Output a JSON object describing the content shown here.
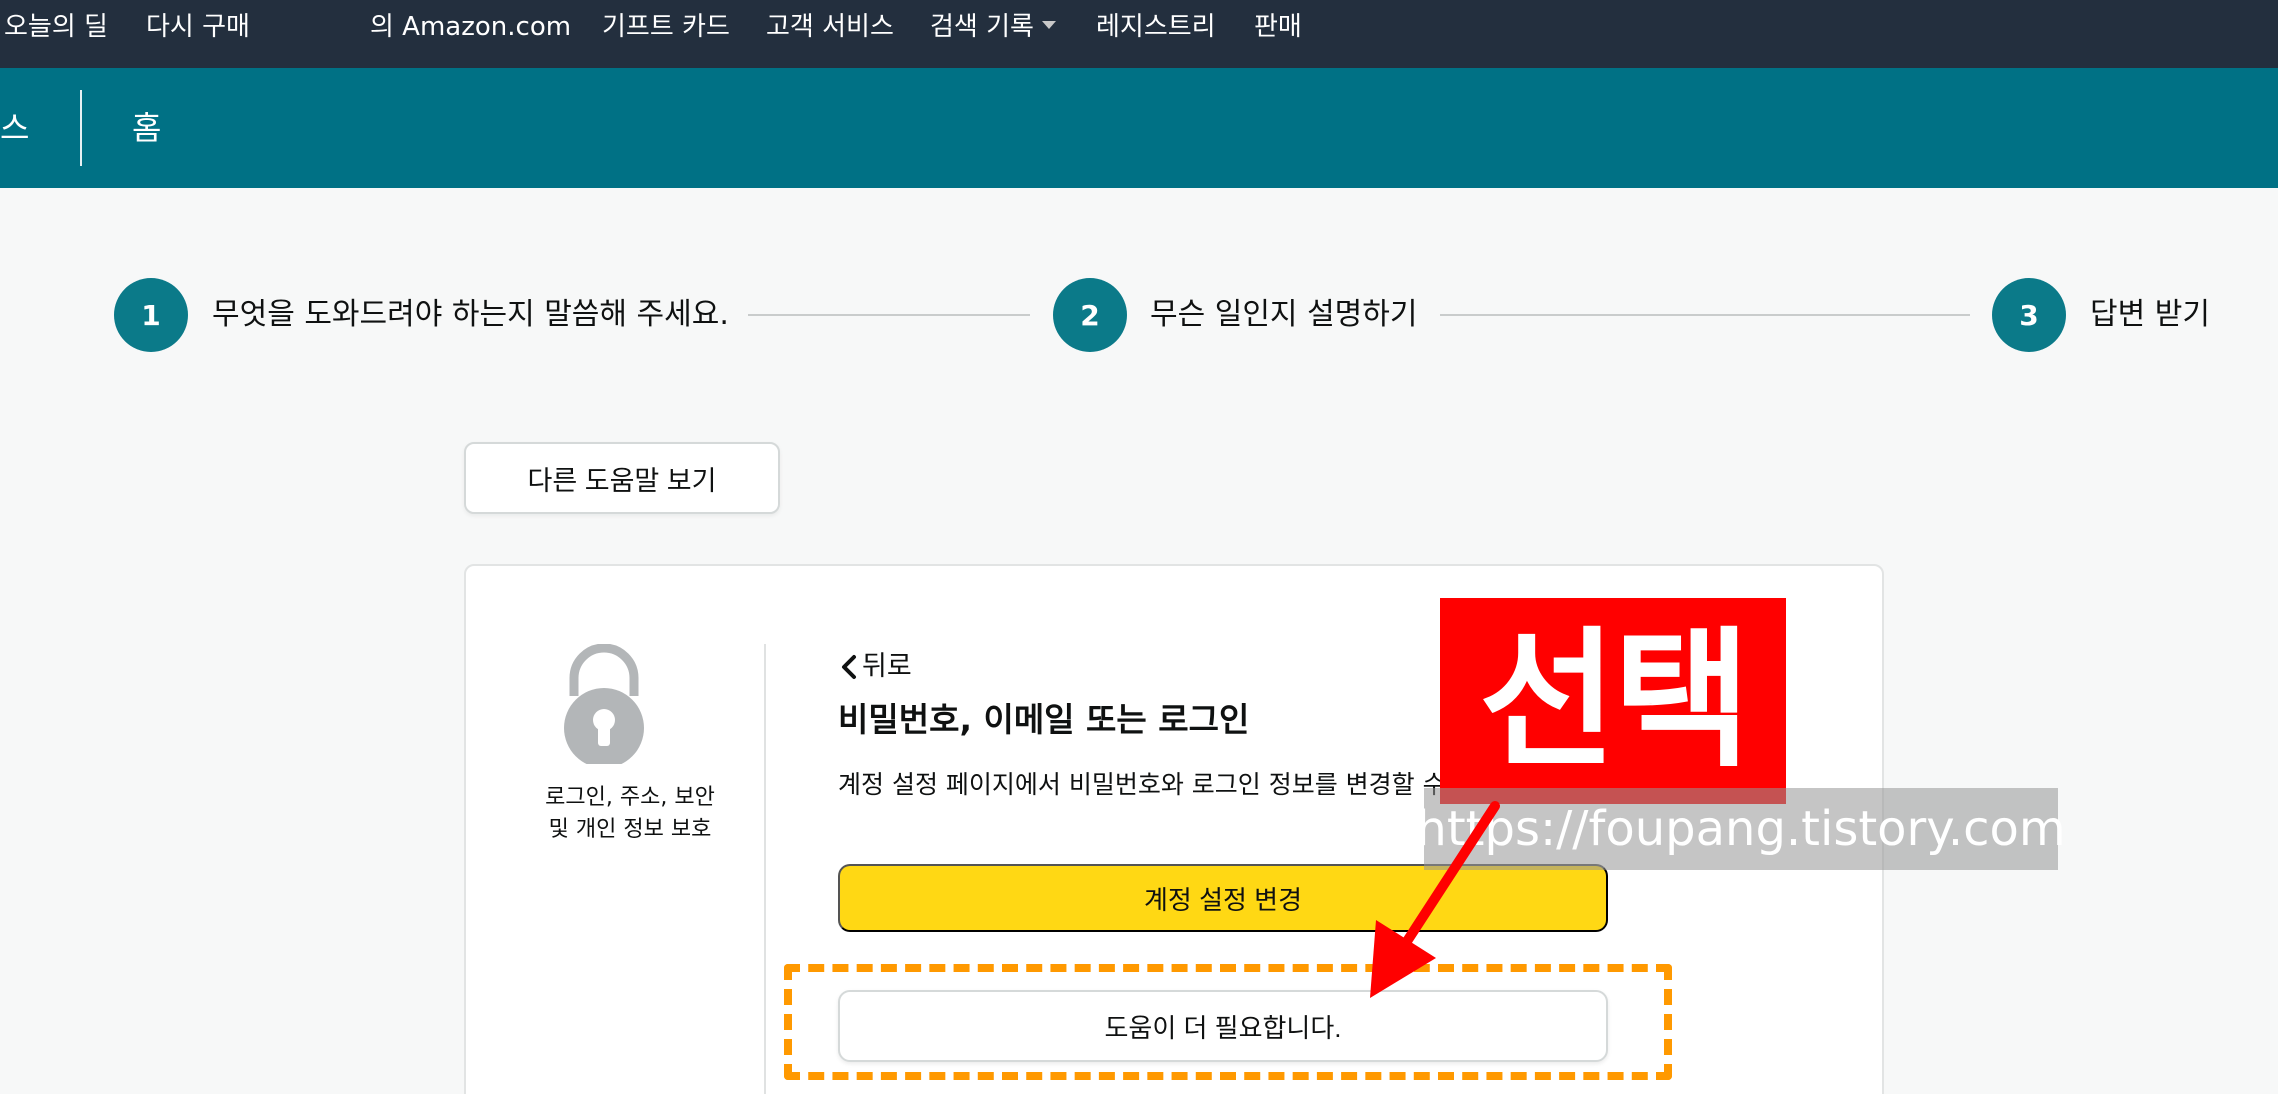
{
  "topnav": {
    "items": [
      "오늘의 딜",
      "다시 구매",
      "의 Amazon.com",
      "기프트 카드",
      "고객 서비스",
      "검색 기록",
      "레지스트리",
      "판매"
    ]
  },
  "subnav": {
    "cut_label": "스",
    "home": "홈"
  },
  "steps": [
    {
      "number": "1",
      "label": "무엇을 도와드려야 하는지 말씀해 주세요."
    },
    {
      "number": "2",
      "label": "무슨 일인지 설명하기"
    },
    {
      "number": "3",
      "label": "답변 받기"
    }
  ],
  "other_help_label": "다른 도움말 보기",
  "card": {
    "caption_line1": "로그인, 주소, 보안",
    "caption_line2": "및 개인 정보 보호",
    "back_label": "뒤로",
    "title": "비밀번호, 이메일 또는 로그인",
    "description": "계정 설정 페이지에서 비밀번호와 로그인 정보를 변경할 수 있",
    "primary_button": "계정 설정 변경",
    "secondary_button": "도움이 더 필요합니다."
  },
  "annotation": {
    "stamp_text": "선택",
    "watermark": "https://foupang.tistory.com",
    "highlight_color": "#ff9900",
    "stamp_color": "#ff0000"
  },
  "colors": {
    "topnav_bg": "#232f3e",
    "subbar_bg": "#007185",
    "step_circle": "#0b7a89",
    "primary_button": "#ffd814"
  }
}
